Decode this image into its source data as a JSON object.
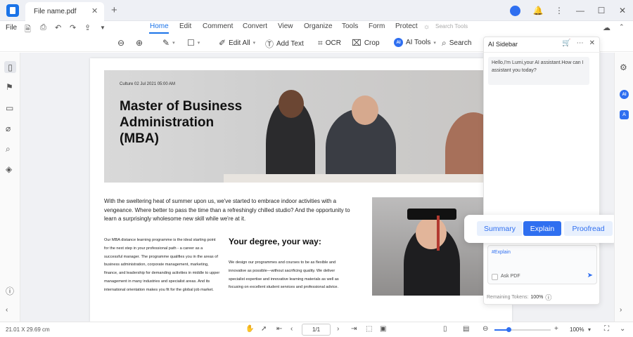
{
  "titlebar": {
    "tab_label": "File name.pdf",
    "close_glyph": "✕",
    "add_glyph": "+",
    "window_controls": [
      "🔔",
      "⋮",
      "—",
      "☐",
      "✕"
    ]
  },
  "menubar": {
    "file": "File",
    "tabs": [
      "Home",
      "Edit",
      "Comment",
      "Convert",
      "View",
      "Organize",
      "Tools",
      "Form",
      "Protect"
    ],
    "search_placeholder": "Search Tools"
  },
  "toolbar": {
    "edit_all": "Edit All",
    "add_text": "Add Text",
    "ocr": "OCR",
    "crop": "Crop",
    "ai_badge": "AI",
    "ai_tools": "AI Tools",
    "search": "Search"
  },
  "document": {
    "hero_meta": "Culture 02 Jul 2021 05:00 AM",
    "hero_title": "Master of Business Administration (MBA)",
    "intro": "With the sweltering heat of summer upon us, we've started to embrace indoor activities with a vengeance. Where better to pass the time than a refreshingly chilled studio? And the opportunity to learn a surprisingly wholesome new skill while we're at it.",
    "left_column": "Our MBA distance learning programme is the ideal starting point for the next step in your professional path - a career as a successful manager. The programme qualifies you in the areas of business administration, corporate management, marketing, finance, and leadership for demanding activities in middle to upper management in many industries and specialist areas. And its international orientation makes you fit for the global job market.",
    "right_heading": "Your degree, your way:",
    "right_column": "We design our programmes and courses to be as flexible and innovative as possible—without sacrificing quality. We deliver specialist expertise and innovative learning materials as well as focusing on excellent student services and professional advice."
  },
  "ai_sidebar": {
    "title": "AI Sidebar",
    "greeting": "Hello,I'm Lumi,your AI assistant.How can I assistant you today?",
    "input_text": "#Explain",
    "ask_pdf": "Ask PDF",
    "tokens_label": "Remaining Tokens:",
    "tokens_value": "100%"
  },
  "popup": {
    "summary": "Summary",
    "explain": "Explain",
    "proofread": "Proofread"
  },
  "statusbar": {
    "dimensions": "21.01 X 29.69 cm",
    "page": "1/1",
    "zoom": "100%",
    "zoom_fraction": 0.25
  }
}
